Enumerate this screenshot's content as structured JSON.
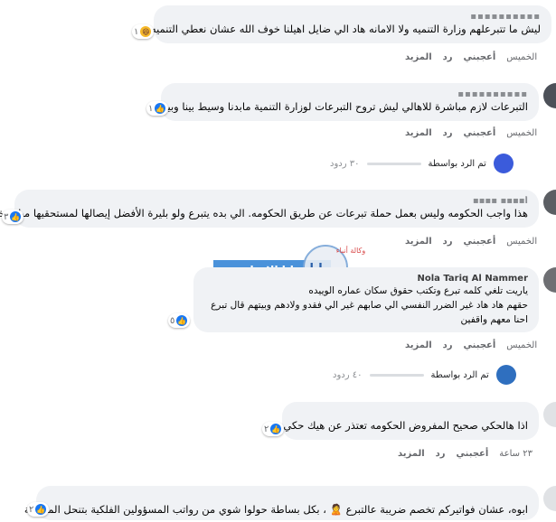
{
  "comments": [
    {
      "name": "▪▪▪▪▪▪▪▪▪▪",
      "text": "ليش ما تتبرعلهم وزارة التنميه ولا الامانه هاد الي ضايل اهيلنا خوف الله عشان نعطي التنميه",
      "reaction_icon": "haha-icon",
      "reaction_count": "١",
      "time": "الخميس",
      "like_label": "أعجبني",
      "reply_label": "رد",
      "more_label": "المزيد"
    },
    {
      "name": "▪▪▪▪▪▪▪▪▪▪",
      "text": "التبرعات لازم مباشرة للاهالي ليش تروح التبرعات لوزارة التنمية مابدنا وسيط بينا وبينهم",
      "reaction_icon": "like-icon",
      "reaction_count": "١",
      "time": "الخميس",
      "like_label": "أعجبني",
      "reply_label": "رد",
      "more_label": "المزيد"
    },
    {
      "name": "أ▪▪▪▪ ▪▪▪▪",
      "text": "هذا واجب الحكومه وليس بعمل حملة تبرعات عن طريق الحكومه. الي بده يتبرع ولو بليرة الأفضل إيصالها لمستحقيها مباشرة",
      "reaction_icon": "like-icon",
      "reaction_count": "٣",
      "time": "الخميس",
      "like_label": "أعجبني",
      "reply_label": "رد",
      "more_label": "المزيد"
    },
    {
      "name": "Nola Tariq Al Nammer",
      "text_lines": [
        "ياريت تلغي كلمه تبرع وتكتب حقوق سكان عماره الوييده",
        "حقهم هاد هاد غير الضرر النفسي الي صابهم غير الي فقدو ولادهم وبيتهم قال تبرع",
        "احنا معهم واقفين"
      ],
      "reaction_icon": "like-icon",
      "reaction_count": "٥",
      "time": "الخميس",
      "like_label": "أعجبني",
      "reply_label": "رد",
      "more_label": "المزيد"
    },
    {
      "name": "",
      "text": "اذا هالحكي صحيح المفروض الحكومه تعتذر عن هيك حكي",
      "reaction_icon": "like-icon",
      "reaction_count": "٢",
      "time": "٢٣ ساعة",
      "like_label": "أعجبني",
      "reply_label": "رد",
      "more_label": "المزيد"
    },
    {
      "name": "",
      "text": "ابوه، عشان فواتيركم تخصم ضريبة عالتبرع 🙎 ، بكل بساطة حولوا شوي من رواتب المسؤولين الفلكية بتنحل المشكلة",
      "reaction_icon": "like-icon",
      "reaction_count": "٢"
    }
  ],
  "reply_threads": [
    {
      "by_label": "تم الرد بواسطة",
      "count_label": "٣٠ ردود"
    },
    {
      "by_label": "تم الرد بواسطة",
      "count_label": "٤٠ ردود"
    }
  ],
  "watermark": {
    "line1": "وكالة أنباء",
    "line2": "سرايا",
    "line3": "سرايا الإخبارية"
  }
}
